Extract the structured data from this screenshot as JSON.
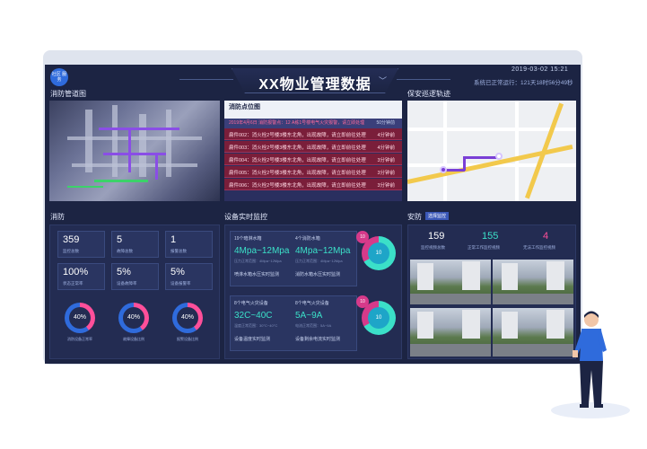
{
  "header": {
    "title": "XX物业管理数据",
    "logo_text": "社区 服务",
    "datetime": "2019-03-02    15:21",
    "uptime": "系统已正常运行：121天18时56分49秒"
  },
  "sections": {
    "fire_pipe": "消防管道图",
    "fire_points": "消防点位图",
    "patrol": "保安巡逻轨迹",
    "fire": "消防",
    "device": "设备实时监控",
    "security": "安防",
    "security_tag": "选择监控"
  },
  "fire_points": {
    "alert": "2019年4月6日 消防报警点：12 A栋1号楼电气火灾报警，请立即处理",
    "alert_time": "50分钟前",
    "rows": [
      {
        "text": "扁件002：消火栓2号楼3楼东北角，出现故障，请立即前往处理",
        "time": "4分钟前"
      },
      {
        "text": "扁件003：消火栓2号楼3楼东北角，出现故障，请立即前往处理",
        "time": "4分钟前"
      },
      {
        "text": "扁件004：消火栓2号楼3楼东北角，出现故障，请立即前往处理",
        "time": "3分钟前"
      },
      {
        "text": "扁件005：消火栓2号楼3楼东北角，出现故障，请立即前往处理",
        "time": "3分钟前"
      },
      {
        "text": "扁件006：消火栓2号楼3楼东北角，出现故障，请立即前往处理",
        "time": "3分钟前"
      }
    ]
  },
  "fire_stats": [
    {
      "value": "359",
      "label": "监控总数"
    },
    {
      "value": "5",
      "label": "故障总数"
    },
    {
      "value": "1",
      "label": "报警总数"
    },
    {
      "value": "100%",
      "label": "状态正常率"
    },
    {
      "value": "5%",
      "label": "设备故障率"
    },
    {
      "value": "5%",
      "label": "设备报警率"
    }
  ],
  "fire_rings": [
    {
      "value": "40%",
      "label": "消防设备正常率",
      "percent": 40
    },
    {
      "value": "40%",
      "label": "故障设备比例",
      "percent": 40
    },
    {
      "value": "40%",
      "label": "报警设备比例",
      "percent": 40
    }
  ],
  "devices": [
    {
      "title": "19个暗淋水箱",
      "value": "4Mpa~12Mpa",
      "sub": "压力正常范围：4Mpa~12Mpa",
      "foot": "喷淋水箱水压实时监测"
    },
    {
      "title": "4个消防水箱",
      "value": "4Mpa~12Mpa",
      "sub": "压力正常范围：4Mpa~12Mpa",
      "foot": "消防水箱水压实时监测"
    },
    {
      "title": "8个电气火灾设备",
      "value": "32C~40C",
      "sub": "温度正常范围：30°C~40°C",
      "foot": "设备温度实时监测"
    },
    {
      "title": "8个电气火灾设备",
      "value": "5A~9A",
      "sub": "电流正常范围：5A~9A",
      "foot": "设备剩余电流实时监测"
    }
  ],
  "gauges": [
    {
      "center": "10",
      "top": "10"
    },
    {
      "center": "10",
      "top": "10"
    }
  ],
  "security_stats": [
    {
      "value": "159",
      "label": "监控视频总数",
      "color": "#ffffff"
    },
    {
      "value": "155",
      "label": "正常工作监控视频",
      "color": "#3be0c8"
    },
    {
      "value": "4",
      "label": "无法工作监控视频",
      "color": "#ff4f9a"
    }
  ],
  "colors": {
    "background": "#1c2443",
    "panel": "#232c52",
    "accent_cyan": "#3be0c8",
    "accent_pink": "#ff4f9a",
    "alert_red": "#7a1e3a"
  }
}
